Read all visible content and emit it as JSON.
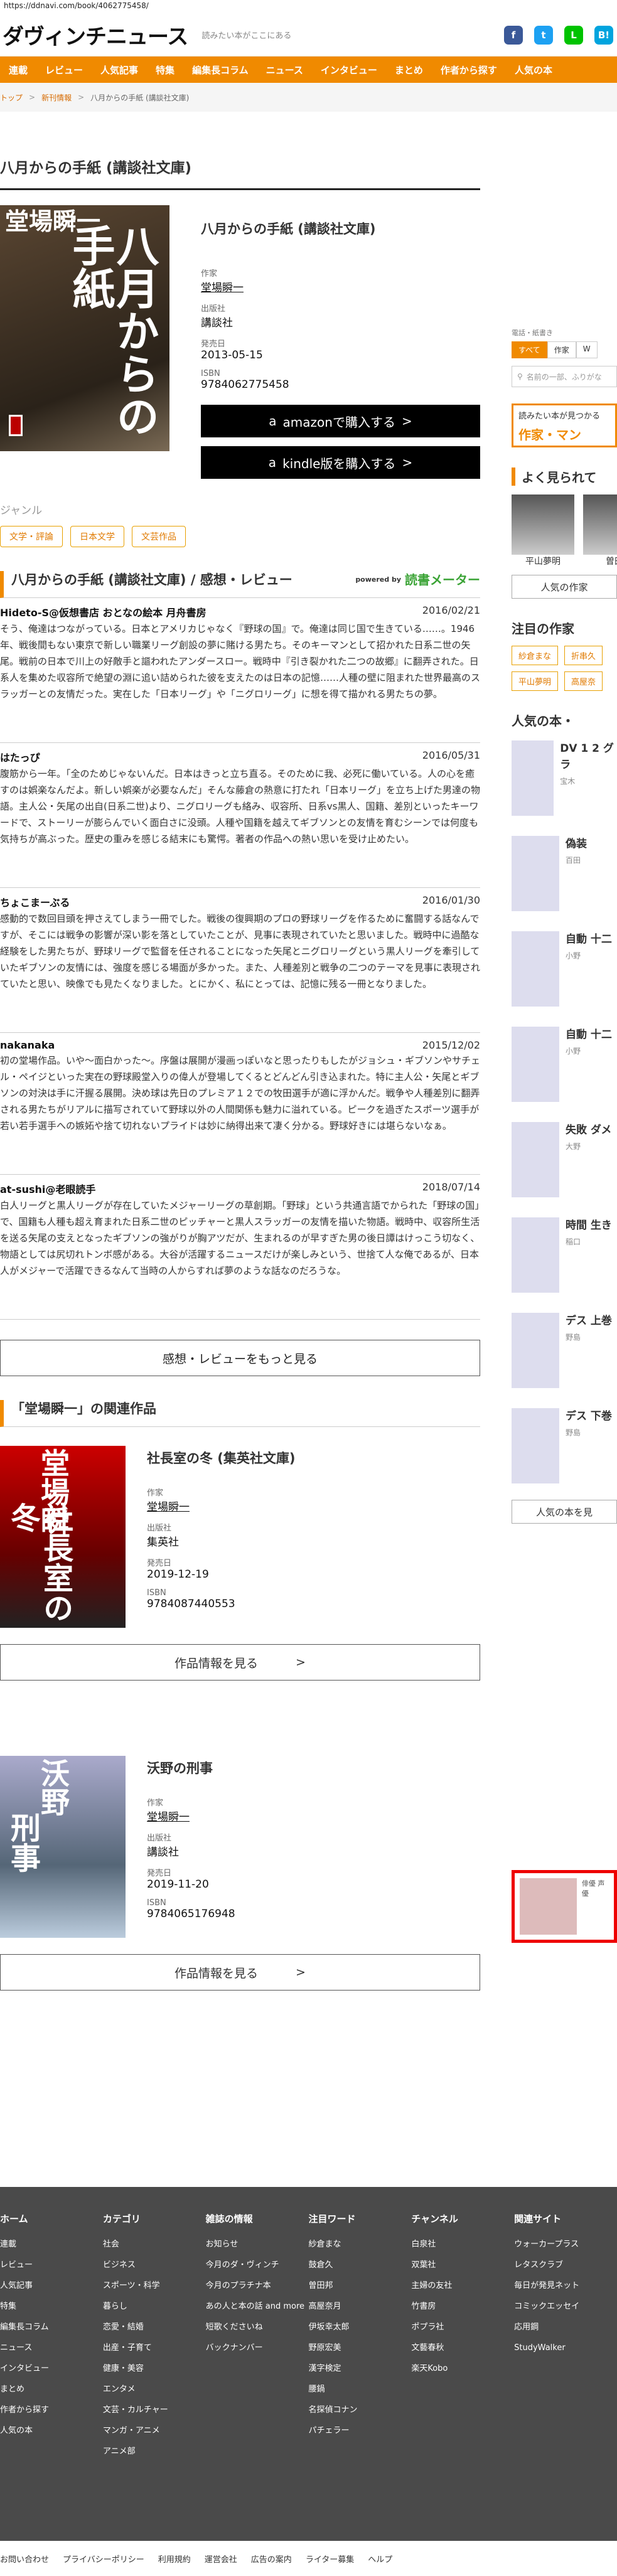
{
  "url": "https://ddnavi.com/book/4062775458/",
  "header": {
    "logo": "ダヴィンチニュース",
    "tagline": "読みたい本がここにある",
    "social": [
      {
        "name": "facebook-icon",
        "glyph": "f",
        "color": "#3b5998"
      },
      {
        "name": "twitter-icon",
        "glyph": "t",
        "color": "#1da1f2"
      },
      {
        "name": "line-icon",
        "glyph": "L",
        "color": "#00c300"
      },
      {
        "name": "hatena-icon",
        "glyph": "B!",
        "color": "#00a4de"
      }
    ]
  },
  "nav": [
    "連載",
    "レビュー",
    "人気記事",
    "特集",
    "編集長コラム",
    "ニュース",
    "インタビュー",
    "まとめ",
    "作者から探す",
    "人気の本"
  ],
  "breadcrumb": [
    "トップ",
    "新刊情報",
    "八月からの手紙 (講談社文庫)"
  ],
  "page_title": "八月からの手紙 (講談社文庫)",
  "book": {
    "cover_author": "堂場瞬一",
    "cover_title": "八月からの手紙",
    "title": "八月からの手紙 (講談社文庫)",
    "author_label": "作家",
    "author": "堂場瞬一",
    "publisher_label": "出版社",
    "publisher": "講談社",
    "date_label": "発売日",
    "date": "2013-05-15",
    "isbn_label": "ISBN",
    "isbn": "9784062775458",
    "amazon": "amazonで購入する",
    "kindle": "kindle版を購入する"
  },
  "genre": {
    "heading": "ジャンル",
    "tags": [
      "文学・評論",
      "日本文学",
      "文芸作品"
    ]
  },
  "reviews_section": {
    "title": "八月からの手紙 (講談社文庫) / 感想・レビュー",
    "powered": "powered by",
    "meter": "読書メーター",
    "more": "感想・レビューをもっと見る"
  },
  "reviews": [
    {
      "user": "Hideto-S@仮想書店 おとなの絵本 月舟書房",
      "date": "2016/02/21",
      "text": "そう、俺達はつながっている。日本とアメリカじゃなく『野球の国』で。俺達は同じ国で生きている……。1946年、戦後間もない東京で新しい職業リーグ創設の夢に賭ける男たち。そのキーマンとして招かれた日系二世の矢尾。戦前の日本で川上の好敵手と謳われたアンダースロー。戦時中『引き裂かれた二つの故郷』に翻弄された。日系人を集めた収容所で絶望の淵に追い詰められた彼を支えたのは日本の記憶……人種の壁に阻まれた世界最高のスラッガーとの友情だった。実在した「日本リーグ」や「ニグロリーグ」に想を得て描かれる男たちの夢。"
    },
    {
      "user": "はたっぴ",
      "date": "2016/05/31",
      "text": "腹筋から一年。「全のためじゃないんだ。日本はきっと立ち直る。そのために我、必死に働いている。人の心を癒すのは娯楽なんだよ。新しい娯楽が必要なんだ」そんな藤倉の熱意に打たれ「日本リーグ」を立ち上げた男達の物語。主人公・矢尾の出自(日系二世)より、ニグロリーグも絡み、収容所、日系vs黒人、国籍、差別といったキーワードで、ストーリーが膨らんでいく面白さに没頭。人種や国籍を越えてギブソンとの友情を育むシーンでは何度も気持ちが高ぶった。歴史の重みを感じる結末にも驚愕。著者の作品への熱い思いを受け止めたい。"
    },
    {
      "user": "ちょこまーぶる",
      "date": "2016/01/30",
      "text": "感動的で数回目頭を押さえてしまう一冊でした。戦後の復興期のプロの野球リーグを作るために奮闘する話なんですが、そこには戦争の影響が深い影を落としていたことが、見事に表現されていたと思いました。戦時中に過酷な経験をした男たちが、野球リーグで監督を任されることになった矢尾とニグロリーグという黒人リーグを牽引していたギブソンの友情には、強度を感じる場面が多かった。また、人種差別と戦争の二つのテーマを見事に表現されていたと思い、映像でも見たくなりました。とにかく、私にとっては、記憶に残る一冊となりました。"
    },
    {
      "user": "nakanaka",
      "date": "2015/12/02",
      "text": "初の堂場作品。いや〜面白かった〜。序盤は展開が漫画っぽいなと思ったりもしたがジョシュ・ギブソンやサチェル・ペイジといった実在の野球殿堂入りの偉人が登場してくるとどんどん引き込まれた。特に主人公・矢尾とギブソンの対決は手に汗握る展開。決め球は先日のプレミア１２での牧田選手が適に浮かんだ。戦争や人種差別に翻弄される男たちがリアルに描写されていて野球以外の人間関係も魅力に溢れている。ピークを過ぎたスポーツ選手が若い若手選手への嫉妬や捨て切れないプライドは妙に納得出来て凄く分かる。野球好きには堪らないなぁ。"
    },
    {
      "user": "at-sushi@老眼読手",
      "date": "2018/07/14",
      "text": "白人リーグと黒人リーグが存在していたメジャーリーグの草創期。「野球」という共通言語でかられた「野球の国」で、国籍も人種も超え育まれた日系二世のピッチャーと黒人スラッガーの友情を描いた物語。戦時中、収容所生活を送る矢尾の支えとなったギブソンの強がりが胸アツだが、生まれるのが早すぎた男の後日譚はけっこう切なく、物語としては尻切れトンボ感がある。大谷が活躍するニュースだけが楽しみという、世捨て人な俺であるが、日本人がメジャーで活躍できるなんて当時の人からすれば夢のような話なのだろうな。"
    }
  ],
  "related": {
    "title": "「堂場瞬一」の関連作品",
    "view": "作品情報を見る",
    "items": [
      {
        "cover_a": "堂場瞬",
        "cover_b": "社長室の冬",
        "title": "社長室の冬 (集英社文庫)",
        "author_label": "作家",
        "author": "堂場瞬一",
        "publisher_label": "出版社",
        "publisher": "集英社",
        "date_label": "発売日",
        "date": "2019-12-19",
        "isbn_label": "ISBN",
        "isbn": "9784087440553"
      },
      {
        "cover_a": "沃野",
        "cover_b": "刑事",
        "title": "沃野の刑事",
        "author_label": "作家",
        "author": "堂場瞬一",
        "publisher_label": "出版社",
        "publisher": "講談社",
        "date_label": "発売日",
        "date": "2019-11-20",
        "isbn_label": "ISBN",
        "isbn": "9784065176948"
      }
    ]
  },
  "side": {
    "search_label": "電話・紙書き",
    "seg": [
      "すべて",
      "作家",
      "W"
    ],
    "search_placeholder": "名前の一部、ふりがな",
    "ad_text": "読みたい本が見つかる",
    "ad_big": "作家・マン",
    "popular": "よく見られて",
    "people": [
      {
        "name": "平山夢明"
      },
      {
        "name": "曽田"
      }
    ],
    "pop_btn": "人気の作家",
    "attention": "注目の作家",
    "chips": [
      "紗倉まな",
      "折串久",
      "平山夢明",
      "高屋奈"
    ],
    "books": "人気の本・",
    "ranks": [
      {
        "t": "DV 1 2 グラ",
        "s": "宝木"
      },
      {
        "t": "偽装",
        "s": "百田"
      },
      {
        "t": "自動 十二",
        "s": "小野"
      },
      {
        "t": "自動 十二",
        "s": "小野"
      },
      {
        "t": "失敗 ダメ",
        "s": "大野"
      },
      {
        "t": "時間 生き",
        "s": "稲口"
      },
      {
        "t": "デス 上巻",
        "s": "野島"
      },
      {
        "t": "デス 下巻",
        "s": "野島"
      }
    ],
    "books_btn": "人気の本を見",
    "video": "俳優 声優"
  },
  "footer": {
    "cols": [
      {
        "h": "ホーム",
        "items": [
          "連載",
          "レビュー",
          "人気記事",
          "特集",
          "編集長コラム",
          "ニュース",
          "インタビュー",
          "まとめ",
          "作者から探す",
          "人気の本"
        ]
      },
      {
        "h": "カテゴリ",
        "items": [
          "社会",
          "ビジネス",
          "スポーツ・科学",
          "暮らし",
          "恋愛・結婚",
          "出産・子育て",
          "健康・美容",
          "エンタメ",
          "文芸・カルチャー",
          "マンガ・アニメ",
          "アニメ部"
        ]
      },
      {
        "h": "雑誌の情報",
        "items": [
          "お知らせ",
          "今月のダ・ヴィンチ",
          "今月のプラチナ本",
          "あの人と本の話 and more",
          "短歌くださいね",
          "バックナンバー"
        ]
      },
      {
        "h": "注目ワード",
        "items": [
          "紗倉まな",
          "鼓倉久",
          "曽田邦",
          "高屋奈月",
          "伊坂幸太郎",
          "野原宏美",
          "漢字検定",
          "腰鍋",
          "名探偵コナン",
          "パチェラー"
        ]
      },
      {
        "h": "チャンネル",
        "items": [
          "白泉社",
          "双葉社",
          "主婦の友社",
          "竹書房",
          "ポプラ社",
          "文藝春秋",
          "楽天Kobo"
        ]
      },
      {
        "h": "関連サイト",
        "items": [
          "ウォーカープラス",
          "レタスクラブ",
          "毎日が発見ネット",
          "コミックエッセイ",
          "応用鋼",
          "StudyWalker"
        ]
      }
    ],
    "bottom": [
      "お問い合わせ",
      "プライバシーポリシー",
      "利用規約",
      "運営会社",
      "広告の案内",
      "ライター募集",
      "ヘルプ"
    ]
  }
}
